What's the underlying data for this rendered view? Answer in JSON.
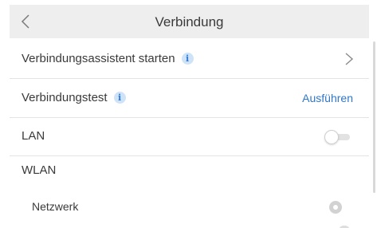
{
  "header": {
    "title": "Verbindung",
    "back_icon": "chevron-left-icon"
  },
  "rows": {
    "assistant": {
      "label": "Verbindungsassistent starten",
      "info_glyph": "i",
      "trailing_icon": "chevron-right-icon"
    },
    "test": {
      "label": "Verbindungstest",
      "info_glyph": "i",
      "action_label": "Ausführen"
    },
    "lan": {
      "label": "LAN",
      "toggle_on": false
    },
    "wlan": {
      "label": "WLAN"
    },
    "network": {
      "label": "Netzwerk",
      "selected": false
    }
  },
  "colors": {
    "accent": "#2f77c8",
    "header_bg": "#eeeeee",
    "info_bg": "#cfe3f8",
    "divider": "#e4e4e4"
  }
}
